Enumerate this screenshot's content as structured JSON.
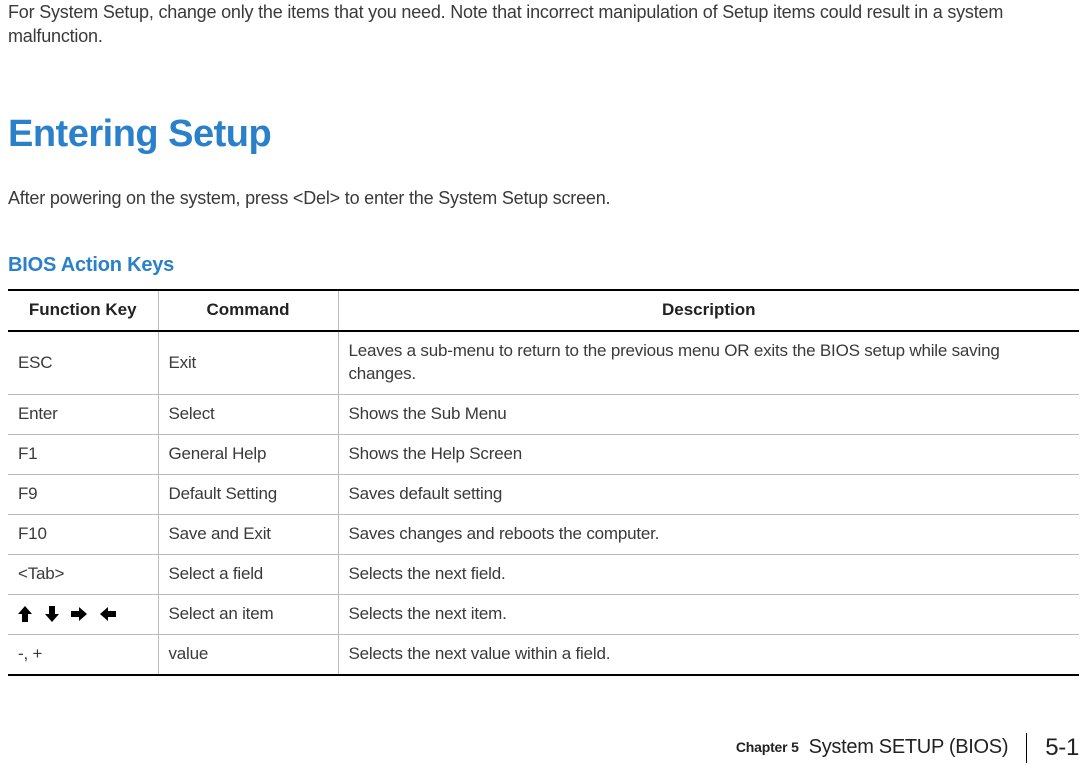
{
  "intro": "For System Setup, change only the items that you need. Note that incorrect manipulation of Setup items could result in a system malfunction.",
  "heading": "Entering Setup",
  "body": "After powering on the system, press <Del> to enter the System Setup screen.",
  "subheading": "BIOS Action Keys",
  "table": {
    "headers": {
      "key": "Function Key",
      "command": "Command",
      "description": "Description"
    },
    "rows": [
      {
        "key": "ESC",
        "command": "Exit",
        "description": "Leaves a sub-menu to return to the previous menu OR exits the BIOS setup while saving changes."
      },
      {
        "key": "Enter",
        "command": "Select",
        "description": "Shows the Sub Menu"
      },
      {
        "key": "F1",
        "command": "General Help",
        "description": "Shows the Help Screen"
      },
      {
        "key": "F9",
        "command": "Default Setting",
        "description": "Saves default setting"
      },
      {
        "key": "F10",
        "command": "Save and Exit",
        "description": "Saves changes and reboots the computer."
      },
      {
        "key": "<Tab>",
        "command": "Select a field",
        "description": "Selects the next field."
      },
      {
        "key": "arrows",
        "command": "Select an item",
        "description": "Selects the next item."
      },
      {
        "key": "-, +",
        "command": "value",
        "description": "Selects the next value within a field."
      }
    ]
  },
  "footer": {
    "chapter": "Chapter 5",
    "title": "System SETUP (BIOS)",
    "page": "5-1"
  }
}
